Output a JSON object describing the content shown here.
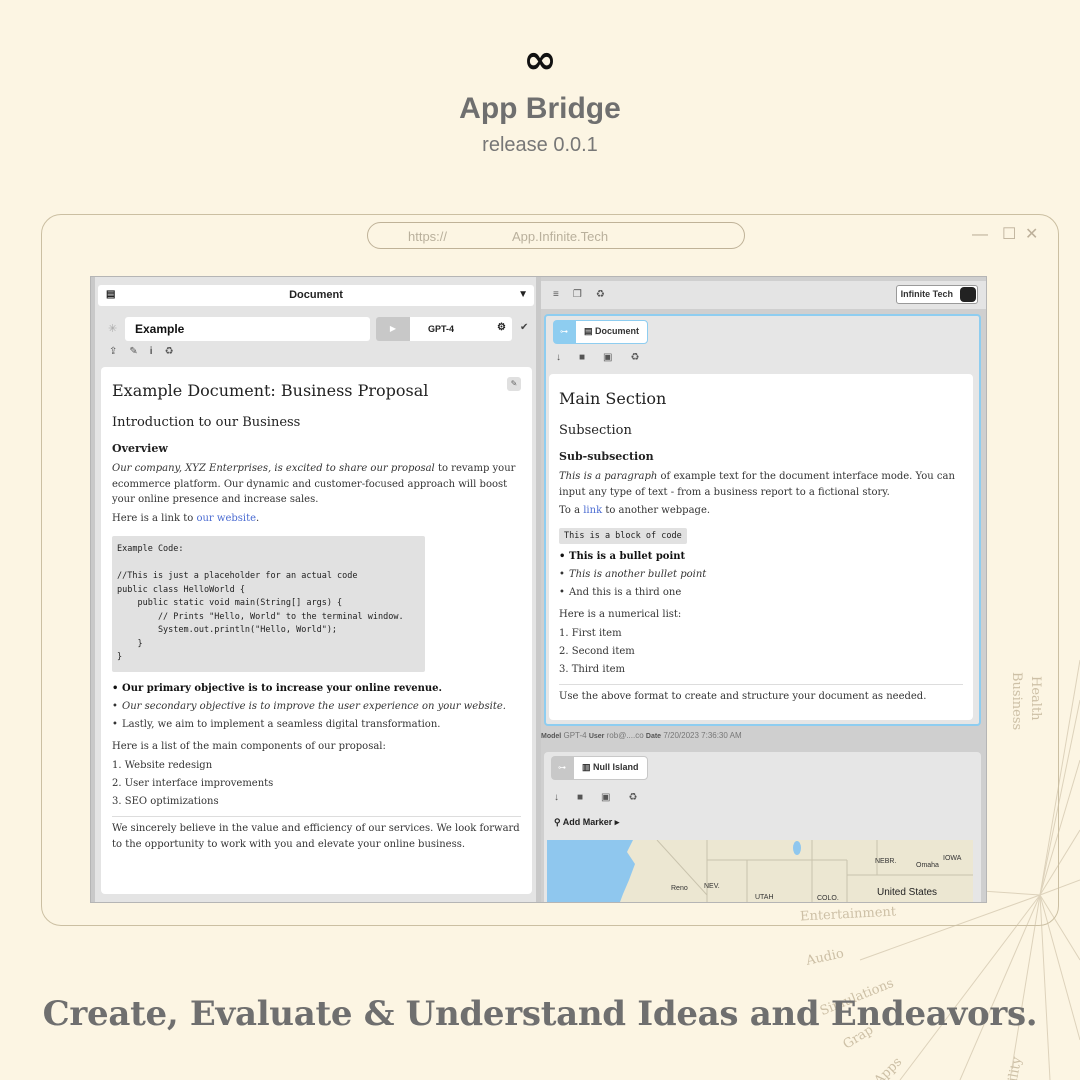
{
  "hero": {
    "logo": "∞",
    "title": "App Bridge",
    "subtitle": "release 0.0.1"
  },
  "browser": {
    "url_protocol": "https://",
    "url_host": "App.Infinite.Tech"
  },
  "left_panel": {
    "document_selector": "Document",
    "doc_name": "Example",
    "model": "GPT-4",
    "content": {
      "h1": "Example Document: Business Proposal",
      "h2": "Introduction to our Business",
      "h3": "Overview",
      "p1_em": "Our company, XYZ Enterprises, is excited to share our proposal",
      "p1_rest": " to revamp your ecommerce platform. Our dynamic and customer-focused approach will boost your online presence and increase sales.",
      "p2_pre": "Here is a link to ",
      "p2_link": "our website",
      "p2_post": ".",
      "code": "Example Code:\n\n//This is just a placeholder for an actual code\npublic class HelloWorld {\n    public static void main(String[] args) {\n        // Prints \"Hello, World\" to the terminal window.\n        System.out.println(\"Hello, World\");\n    }\n}",
      "bullet1": "Our primary objective is to increase your online revenue.",
      "bullet2": "Our secondary objective is to improve the user experience on your website.",
      "bullet3": "Lastly, we aim to implement a seamless digital transformation.",
      "list_intro": "Here is a list of the main components of our proposal:",
      "item1": "1. Website redesign",
      "item2": "2. User interface improvements",
      "item3": "3. SEO optimizations",
      "closing": "We sincerely believe in the value and efficiency of our services. We look forward to the opportunity to work with you and elevate your online business."
    }
  },
  "right_panel": {
    "brand": "Infinite Tech",
    "doc_tab": "Document",
    "content": {
      "h1": "Main Section",
      "h2": "Subsection",
      "h3": "Sub-subsection",
      "p1_em": "This is a paragraph",
      "p1_rest": " of example text for the document interface mode. You can input any type of text - from a business report to a fictional story.",
      "p2_pre": "To a ",
      "p2_link": "link",
      "p2_post": " to another webpage.",
      "code": "This is a block of code",
      "bullet1": "This is a bullet point",
      "bullet2": "This is another bullet point",
      "bullet3": "And this is a third one",
      "list_intro": "Here is a numerical list:",
      "item1": "1. First item",
      "item2": "2. Second item",
      "item3": "3. Third item",
      "closing": "Use the above format to create and structure your document as needed."
    },
    "meta": {
      "model_label": "Model",
      "model": "GPT-4",
      "user_label": "User",
      "user": "rob@....co",
      "date_label": "Date",
      "date": "7/20/2023 7:36:30 AM"
    },
    "map_tab": "Null Island",
    "add_marker": "Add Marker",
    "map_labels": {
      "nebr": "NEBR.",
      "iowa": "IOWA",
      "omaha": "Omaha",
      "nev": "NEV.",
      "reno": "Reno",
      "utah": "UTAH",
      "colo": "COLO.",
      "us": "United States"
    }
  },
  "decor": {
    "health": "Health",
    "business": "Business",
    "entertainment": "Entertainment",
    "audio": "Audio",
    "simulations": "Simulations",
    "graph": "Grap",
    "apps": "Apps",
    "ability": "bility"
  },
  "tagline": "Create, Evaluate & Understand Ideas and Endeavors."
}
